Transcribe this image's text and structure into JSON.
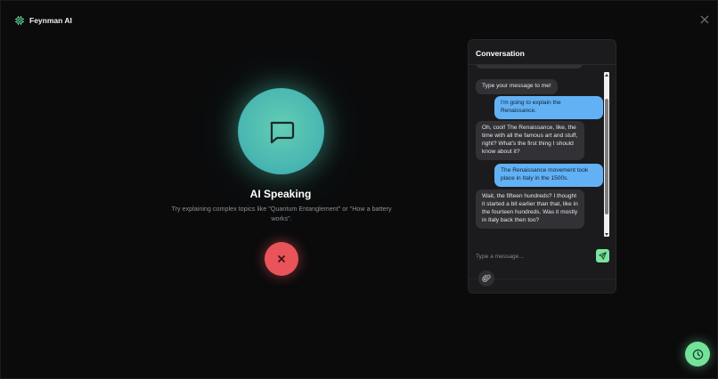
{
  "app": {
    "name": "Feynman AI"
  },
  "speaker": {
    "status": "AI Speaking",
    "hint": "Try explaining complex topics like \"Quantum Entanglement\" or \"How a battery works\"."
  },
  "conversation": {
    "title": "Conversation",
    "messages": [
      {
        "role": "ai",
        "text": "Type your message to me!"
      },
      {
        "role": "user",
        "text": "I'm going to explain the Renaissance."
      },
      {
        "role": "ai",
        "text": "Oh, cool! The Renaissance, like, the time with all the famous art and stuff, right? What's the first thing I should know about it?"
      },
      {
        "role": "user",
        "text": "The Renaissance movement took place in Italy in the 1500s."
      },
      {
        "role": "ai",
        "text": "Wait, the fifteen hundreds? I thought it started a bit earlier than that, like in the fourteen hundreds. Was it mostly in Italy back then too?"
      }
    ],
    "input": {
      "value": "",
      "placeholder": "Type a message..."
    }
  },
  "icons": {
    "brand": "brain-chip-icon",
    "close": "close-icon",
    "orb": "chat-bubble-icon",
    "end_call": "x-icon",
    "send": "send-icon",
    "attach": "paperclip-icon",
    "history": "clock-icon"
  },
  "colors": {
    "accent_green": "#7be39e",
    "orb_teal": "#4bb8b2",
    "end_call_red": "#e8545a",
    "user_bubble": "#62b1f4",
    "ai_bubble": "#323236"
  }
}
